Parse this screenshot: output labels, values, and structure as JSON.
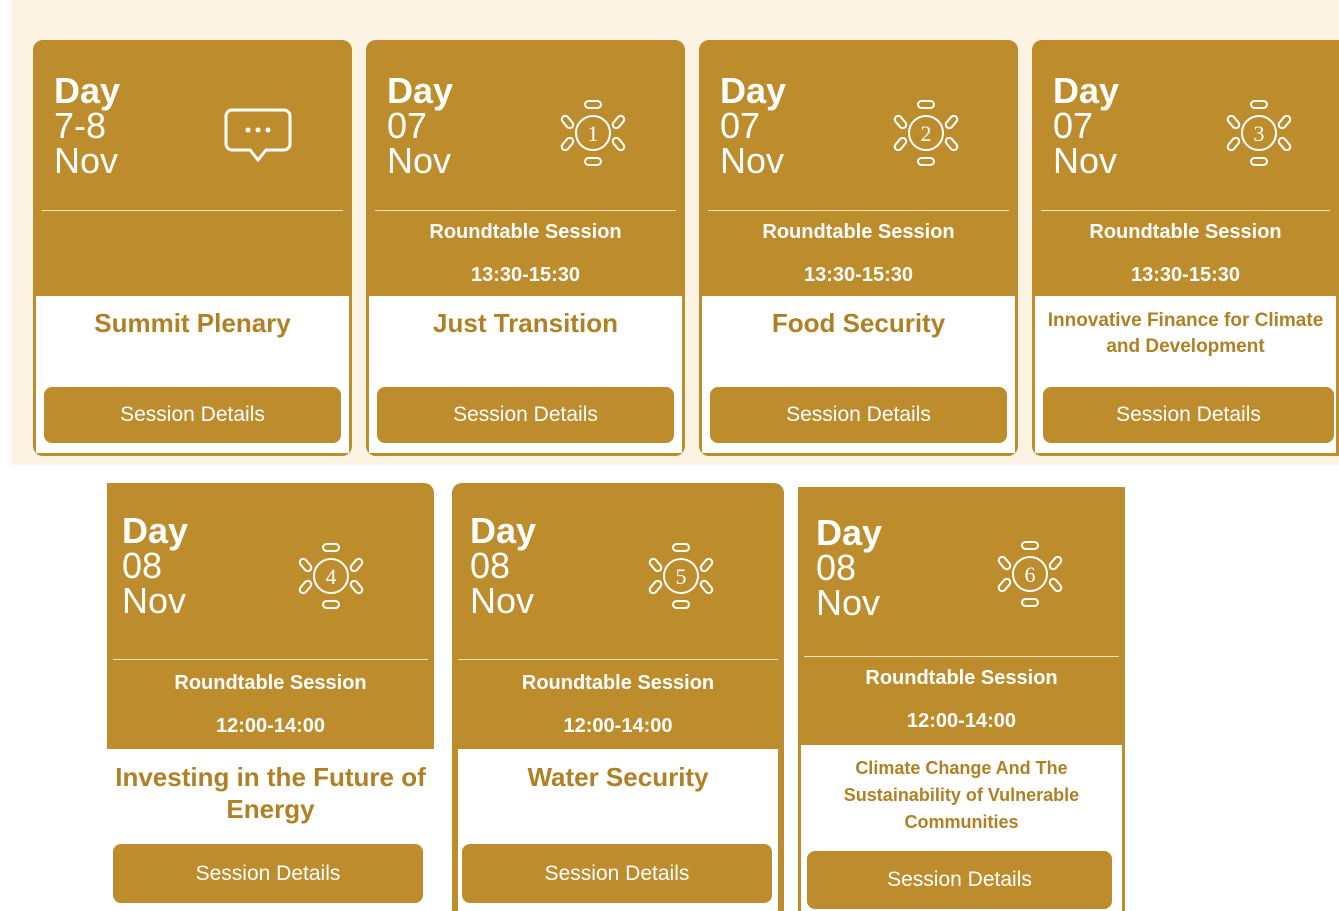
{
  "cards": [
    {
      "day_label": "Day",
      "date": "7-8",
      "month": "Nov",
      "icon": "chat-bubble-icon",
      "table_number": "",
      "session_type": "",
      "time": "",
      "title": "Summit Plenary",
      "button": "Session Details"
    },
    {
      "day_label": "Day",
      "date": "07",
      "month": "Nov",
      "icon": "roundtable-icon",
      "table_number": "1",
      "session_type": "Roundtable Session",
      "time": "13:30-15:30",
      "title": "Just Transition",
      "button": "Session Details"
    },
    {
      "day_label": "Day",
      "date": "07",
      "month": "Nov",
      "icon": "roundtable-icon",
      "table_number": "2",
      "session_type": "Roundtable Session",
      "time": "13:30-15:30",
      "title": "Food Security",
      "button": "Session Details"
    },
    {
      "day_label": "Day",
      "date": "07",
      "month": "Nov",
      "icon": "roundtable-icon",
      "table_number": "3",
      "session_type": "Roundtable Session",
      "time": "13:30-15:30",
      "title": "Innovative Finance for Climate and Development",
      "button": "Session Details"
    },
    {
      "day_label": "Day",
      "date": "08",
      "month": "Nov",
      "icon": "roundtable-icon",
      "table_number": "4",
      "session_type": "Roundtable Session",
      "time": "12:00-14:00",
      "title": "Investing in the Future of Energy",
      "button": "Session Details"
    },
    {
      "day_label": "Day",
      "date": "08",
      "month": "Nov",
      "icon": "roundtable-icon",
      "table_number": "5",
      "session_type": "Roundtable Session",
      "time": "12:00-14:00",
      "title": "Water Security",
      "button": "Session Details"
    },
    {
      "day_label": "Day",
      "date": "08",
      "month": "Nov",
      "icon": "roundtable-icon",
      "table_number": "6",
      "session_type": "Roundtable Session",
      "time": "12:00-14:00",
      "title": "Climate Change And The Sustainability of Vulnerable Communities",
      "button": "Session Details"
    }
  ],
  "colors": {
    "accent": "#bd8c2d",
    "title_text": "#b08024",
    "band": "#fdf3e3"
  }
}
